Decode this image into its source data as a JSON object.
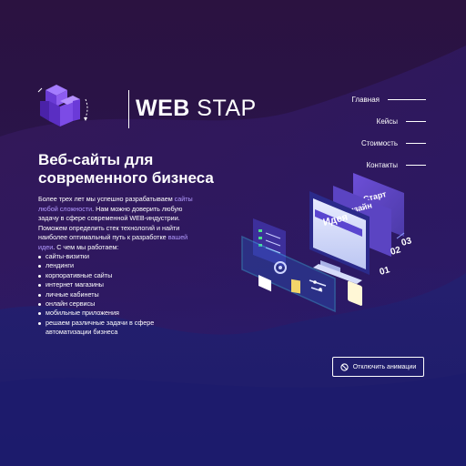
{
  "brand": {
    "name_bold": "WEB",
    "name_light": "STAP"
  },
  "nav": {
    "items": [
      {
        "label": "Главная"
      },
      {
        "label": "Кейсы"
      },
      {
        "label": "Стоимость"
      },
      {
        "label": "Контакты"
      }
    ]
  },
  "hero": {
    "title_line1": "Веб-сайты для",
    "title_line2": "современного бизнеса",
    "intro_part1": "Более трех лет мы успешно разрабатываем ",
    "intro_link1": "сайты любой сложности",
    "intro_part2": ". Нам можно доверить любую задачу в сфере современной WEB-индустрии. Поможем определить стек технологий и найти наиболее оптимальный путь к разработке ",
    "intro_link2": "вашей идеи",
    "intro_part3": ". С чем мы работаем:",
    "services": [
      "сайты-визитки",
      "лендинги",
      "корпоративные сайты",
      "интернет магазины",
      "личные кабинеты",
      "онлайн сервисы",
      "мобильные приложения",
      "решаем различные задачи в сфере автоматизации бизнеса"
    ]
  },
  "illustration": {
    "layers": [
      "Старт",
      "Дизайн",
      "Идея"
    ],
    "steps": [
      "01",
      "02",
      "03"
    ]
  },
  "animation_toggle": {
    "label": "Отключить анимации",
    "icon": "ban-icon"
  },
  "colors": {
    "bg_top": "#2b1240",
    "bg_bottom": "#1c1a6e",
    "accent_purple": "#7b4fe0",
    "link": "#b39bff",
    "cyan_glow": "#3ad7ff"
  }
}
